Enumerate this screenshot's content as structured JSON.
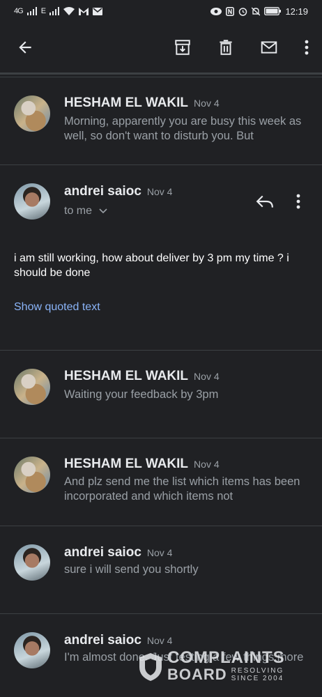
{
  "status_bar": {
    "net1": "4G",
    "net2": "E",
    "time": "12:19",
    "icons": [
      "signal-icon",
      "wifi-icon",
      "gmail-icon",
      "mail-icon",
      "eye-icon",
      "nfc-icon",
      "alarm-icon",
      "bell-off-icon",
      "battery-icon"
    ]
  },
  "toolbar": {
    "icons": [
      "back-arrow-icon",
      "archive-icon",
      "delete-icon",
      "mark-unread-icon",
      "more-vert-icon"
    ]
  },
  "messages": [
    {
      "sender": "HESHAM EL WAKIL",
      "date": "Nov 4",
      "snippet": "Morning, apparently you are busy this week as well, so don't want to disturb you. But"
    },
    {
      "sender": "andrei saioc",
      "date": "Nov 4",
      "to": "to me",
      "body": "i am still working, how about deliver by 3 pm my time ? i should be done",
      "quoted_link": "Show quoted text"
    },
    {
      "sender": "HESHAM EL WAKIL",
      "date": "Nov 4",
      "snippet": "Waiting your feedback by 3pm"
    },
    {
      "sender": "HESHAM EL WAKIL",
      "date": "Nov 4",
      "snippet": "And plz send me the list which items has been incorporated and which items not"
    },
    {
      "sender": "andrei saioc",
      "date": "Nov 4",
      "snippet": "sure i will send you shortly"
    },
    {
      "sender": "andrei saioc",
      "date": "Nov 4",
      "snippet": "I'm almost done. Just testing a few things more"
    }
  ],
  "watermark": {
    "line1": "COMPLAINTS",
    "line2": "BOARD",
    "tag1": "RESOLVING",
    "tag2": "SINCE 2004"
  },
  "colors": {
    "background": "#202124",
    "text": "#e8eaed",
    "secondary": "#9aa0a6",
    "link": "#8ab4f8",
    "divider": "#3c4043"
  }
}
